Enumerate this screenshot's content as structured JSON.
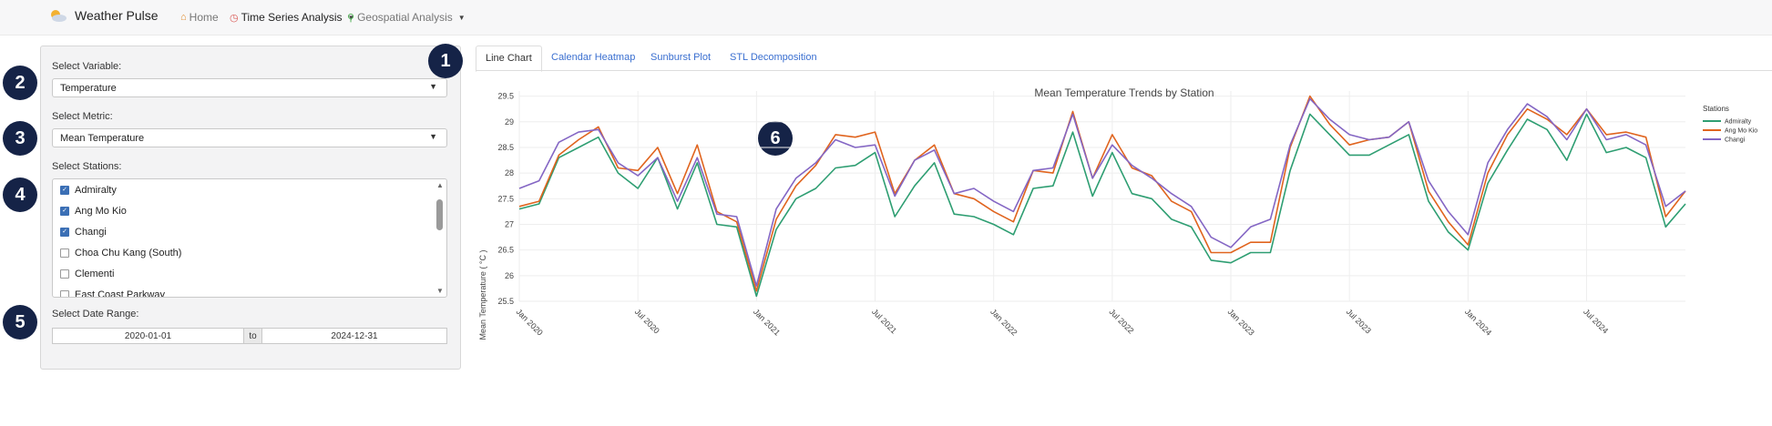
{
  "app": {
    "title": "Weather Pulse",
    "nav": [
      {
        "label": "Home",
        "icon": "home-icon"
      },
      {
        "label": "Time Series Analysis",
        "icon": "clock-icon",
        "active": true
      },
      {
        "label": "Geospatial Analysis",
        "icon": "map-pin-icon"
      }
    ]
  },
  "sidebar": {
    "variable_label": "Select Variable:",
    "variable_value": "Temperature",
    "metric_label": "Select Metric:",
    "metric_value": "Mean Temperature",
    "stations_label": "Select Stations:",
    "stations": [
      {
        "name": "Admiralty",
        "checked": true
      },
      {
        "name": "Ang Mo Kio",
        "checked": true
      },
      {
        "name": "Changi",
        "checked": true
      },
      {
        "name": "Choa Chu Kang (South)",
        "checked": false
      },
      {
        "name": "Clementi",
        "checked": false
      },
      {
        "name": "East Coast Parkway",
        "checked": false
      }
    ],
    "date_label": "Select Date Range:",
    "date_start": "2020-01-01",
    "date_sep": "to",
    "date_end": "2024-12-31"
  },
  "badges": [
    "1",
    "2",
    "3",
    "4",
    "5",
    "6"
  ],
  "tabs": [
    "Line Chart",
    "Calendar Heatmap",
    "Sunburst Plot",
    "STL Decomposition"
  ],
  "chart_data": {
    "type": "line",
    "title": "Mean Temperature Trends by Station",
    "ylabel": "Mean Temperature ( °C )",
    "ylim": [
      25.5,
      29.6
    ],
    "yticks": [
      25.5,
      26,
      26.5,
      27,
      27.5,
      28,
      28.5,
      29,
      29.5
    ],
    "xticks": [
      "Jan 2020",
      "Jul 2020",
      "Jan 2021",
      "Jul 2021",
      "Jan 2022",
      "Jul 2022",
      "Jan 2023",
      "Jul 2023",
      "Jan 2024",
      "Jul 2024"
    ],
    "x_start": "2020-01",
    "legend_title": "Stations",
    "legend_position": "top-right",
    "grid": true,
    "series": [
      {
        "name": "Admiralty",
        "color": "#2e9e72",
        "values": [
          27.3,
          27.4,
          28.3,
          28.5,
          28.7,
          28.0,
          27.7,
          28.3,
          27.3,
          28.2,
          27.0,
          26.95,
          25.6,
          26.9,
          27.5,
          27.7,
          28.1,
          28.15,
          28.4,
          27.15,
          27.75,
          28.2,
          27.2,
          27.15,
          27.0,
          26.8,
          27.7,
          27.75,
          28.8,
          27.55,
          28.4,
          27.6,
          27.5,
          27.1,
          26.95,
          26.3,
          26.25,
          26.45,
          26.45,
          28.05,
          29.15,
          28.75,
          28.35,
          28.35,
          28.55,
          28.75,
          27.45,
          26.85,
          26.5,
          27.8,
          28.45,
          29.05,
          28.85,
          28.25,
          29.15,
          28.4,
          28.5,
          28.3,
          26.95,
          27.4
        ]
      },
      {
        "name": "Ang Mo Kio",
        "color": "#e0641e",
        "values": [
          27.35,
          27.45,
          28.35,
          28.65,
          28.9,
          28.1,
          28.05,
          28.5,
          27.6,
          28.55,
          27.25,
          27.05,
          25.7,
          27.1,
          27.75,
          28.15,
          28.75,
          28.7,
          28.8,
          27.6,
          28.25,
          28.55,
          27.6,
          27.5,
          27.25,
          27.05,
          28.05,
          28.0,
          29.2,
          27.9,
          28.75,
          28.1,
          27.95,
          27.45,
          27.25,
          26.45,
          26.45,
          26.65,
          26.65,
          28.5,
          29.5,
          28.95,
          28.55,
          28.65,
          28.7,
          29.0,
          27.65,
          27.05,
          26.6,
          28.0,
          28.75,
          29.25,
          29.05,
          28.75,
          29.25,
          28.75,
          28.8,
          28.7,
          27.15,
          27.65
        ]
      },
      {
        "name": "Changi",
        "color": "#8466c4",
        "values": [
          27.7,
          27.85,
          28.6,
          28.8,
          28.85,
          28.2,
          27.95,
          28.3,
          27.45,
          28.3,
          27.2,
          27.15,
          25.8,
          27.3,
          27.9,
          28.2,
          28.65,
          28.5,
          28.55,
          27.55,
          28.25,
          28.45,
          27.6,
          27.7,
          27.45,
          27.25,
          28.05,
          28.1,
          29.15,
          27.9,
          28.55,
          28.15,
          27.9,
          27.6,
          27.35,
          26.75,
          26.55,
          26.95,
          27.1,
          28.55,
          29.45,
          29.05,
          28.75,
          28.65,
          28.7,
          29.0,
          27.85,
          27.25,
          26.8,
          28.2,
          28.85,
          29.35,
          29.1,
          28.65,
          29.25,
          28.65,
          28.75,
          28.55,
          27.35,
          27.65
        ]
      }
    ]
  }
}
